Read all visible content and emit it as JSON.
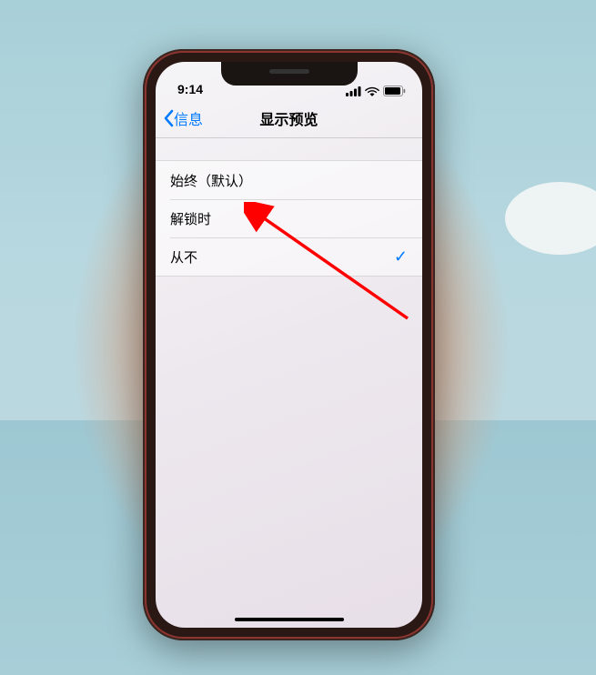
{
  "status_bar": {
    "time": "9:14"
  },
  "nav": {
    "back_label": "信息",
    "title": "显示预览"
  },
  "options": [
    {
      "label": "始终（默认）",
      "selected": false
    },
    {
      "label": "解锁时",
      "selected": false
    },
    {
      "label": "从不",
      "selected": true
    }
  ],
  "annotation": {
    "type": "arrow",
    "target": "option-never"
  }
}
